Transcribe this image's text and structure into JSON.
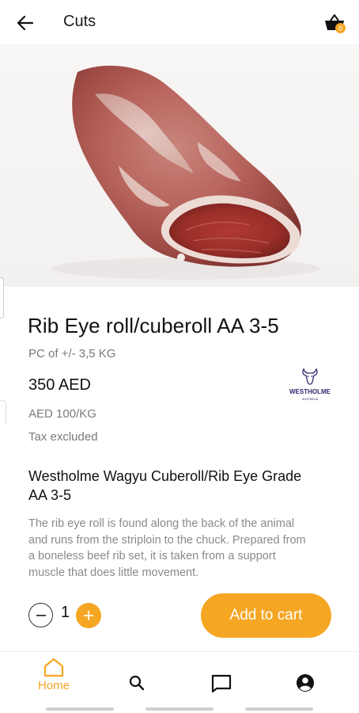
{
  "header": {
    "title": "Cuts",
    "back_icon": "arrow-left-icon",
    "cart_icon": "shopping-basket-icon",
    "cart_badge": "0"
  },
  "product": {
    "title": "Rib Eye roll/cuberoll AA 3-5",
    "pack_size": "PC of +/- 3,5 KG",
    "price": "350 AED",
    "unit_price": "AED 100/KG",
    "tax_note": "Tax excluded",
    "brand_logo_text": "WESTHOLME",
    "brand_logo_subtext": "AUSTRALIA",
    "subtitle": "Westholme Wagyu Cuberoll/Rib Eye Grade AA 3-5",
    "description": "The rib eye roll is found along the back of the animal and runs from the striploin to the chuck. Prepared from a boneless beef rib set, it is taken from a support muscle that does little movement."
  },
  "cart_controls": {
    "quantity": "1",
    "add_to_cart_label": "Add to cart"
  },
  "bottom_nav": {
    "items": [
      {
        "label": "Home",
        "icon": "home-icon",
        "active": true
      },
      {
        "label": "",
        "icon": "search-icon",
        "active": false
      },
      {
        "label": "",
        "icon": "chat-icon",
        "active": false
      },
      {
        "label": "",
        "icon": "account-icon",
        "active": false
      }
    ]
  },
  "colors": {
    "accent": "#f5a623",
    "muted_text": "#7a7a7a",
    "logo_navy": "#2d2a6e"
  }
}
